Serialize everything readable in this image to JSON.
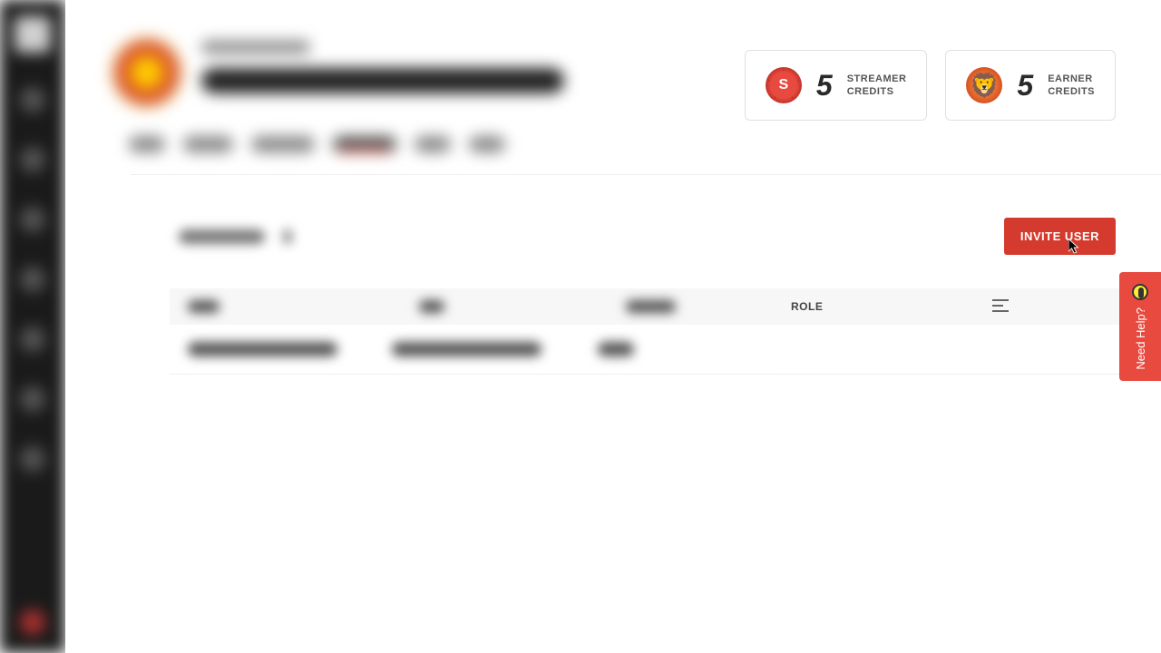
{
  "sidebar": {
    "items": [
      "home",
      "dashboard",
      "users",
      "reports",
      "settings",
      "help",
      "more1",
      "more2"
    ]
  },
  "header": {
    "breadcrumb_obscured": true,
    "title_obscured": true
  },
  "credits": {
    "streamer": {
      "value": "5",
      "label_line1": "STREAMER",
      "label_line2": "CREDITS"
    },
    "earner": {
      "value": "5",
      "label_line1": "EARNER",
      "label_line2": "CREDITS"
    }
  },
  "tabs": {
    "count": 6,
    "active_index": 3
  },
  "subheader": {
    "title_obscured": true,
    "invite_label": "INVITE USER"
  },
  "table": {
    "columns": {
      "role": "ROLE"
    },
    "rows": [
      {
        "obscured": true
      }
    ]
  },
  "help": {
    "label": "Need Help?"
  },
  "colors": {
    "accent": "#d43a2d",
    "danger": "#e84a3f",
    "sidebar_bg": "#1a1a1a"
  }
}
